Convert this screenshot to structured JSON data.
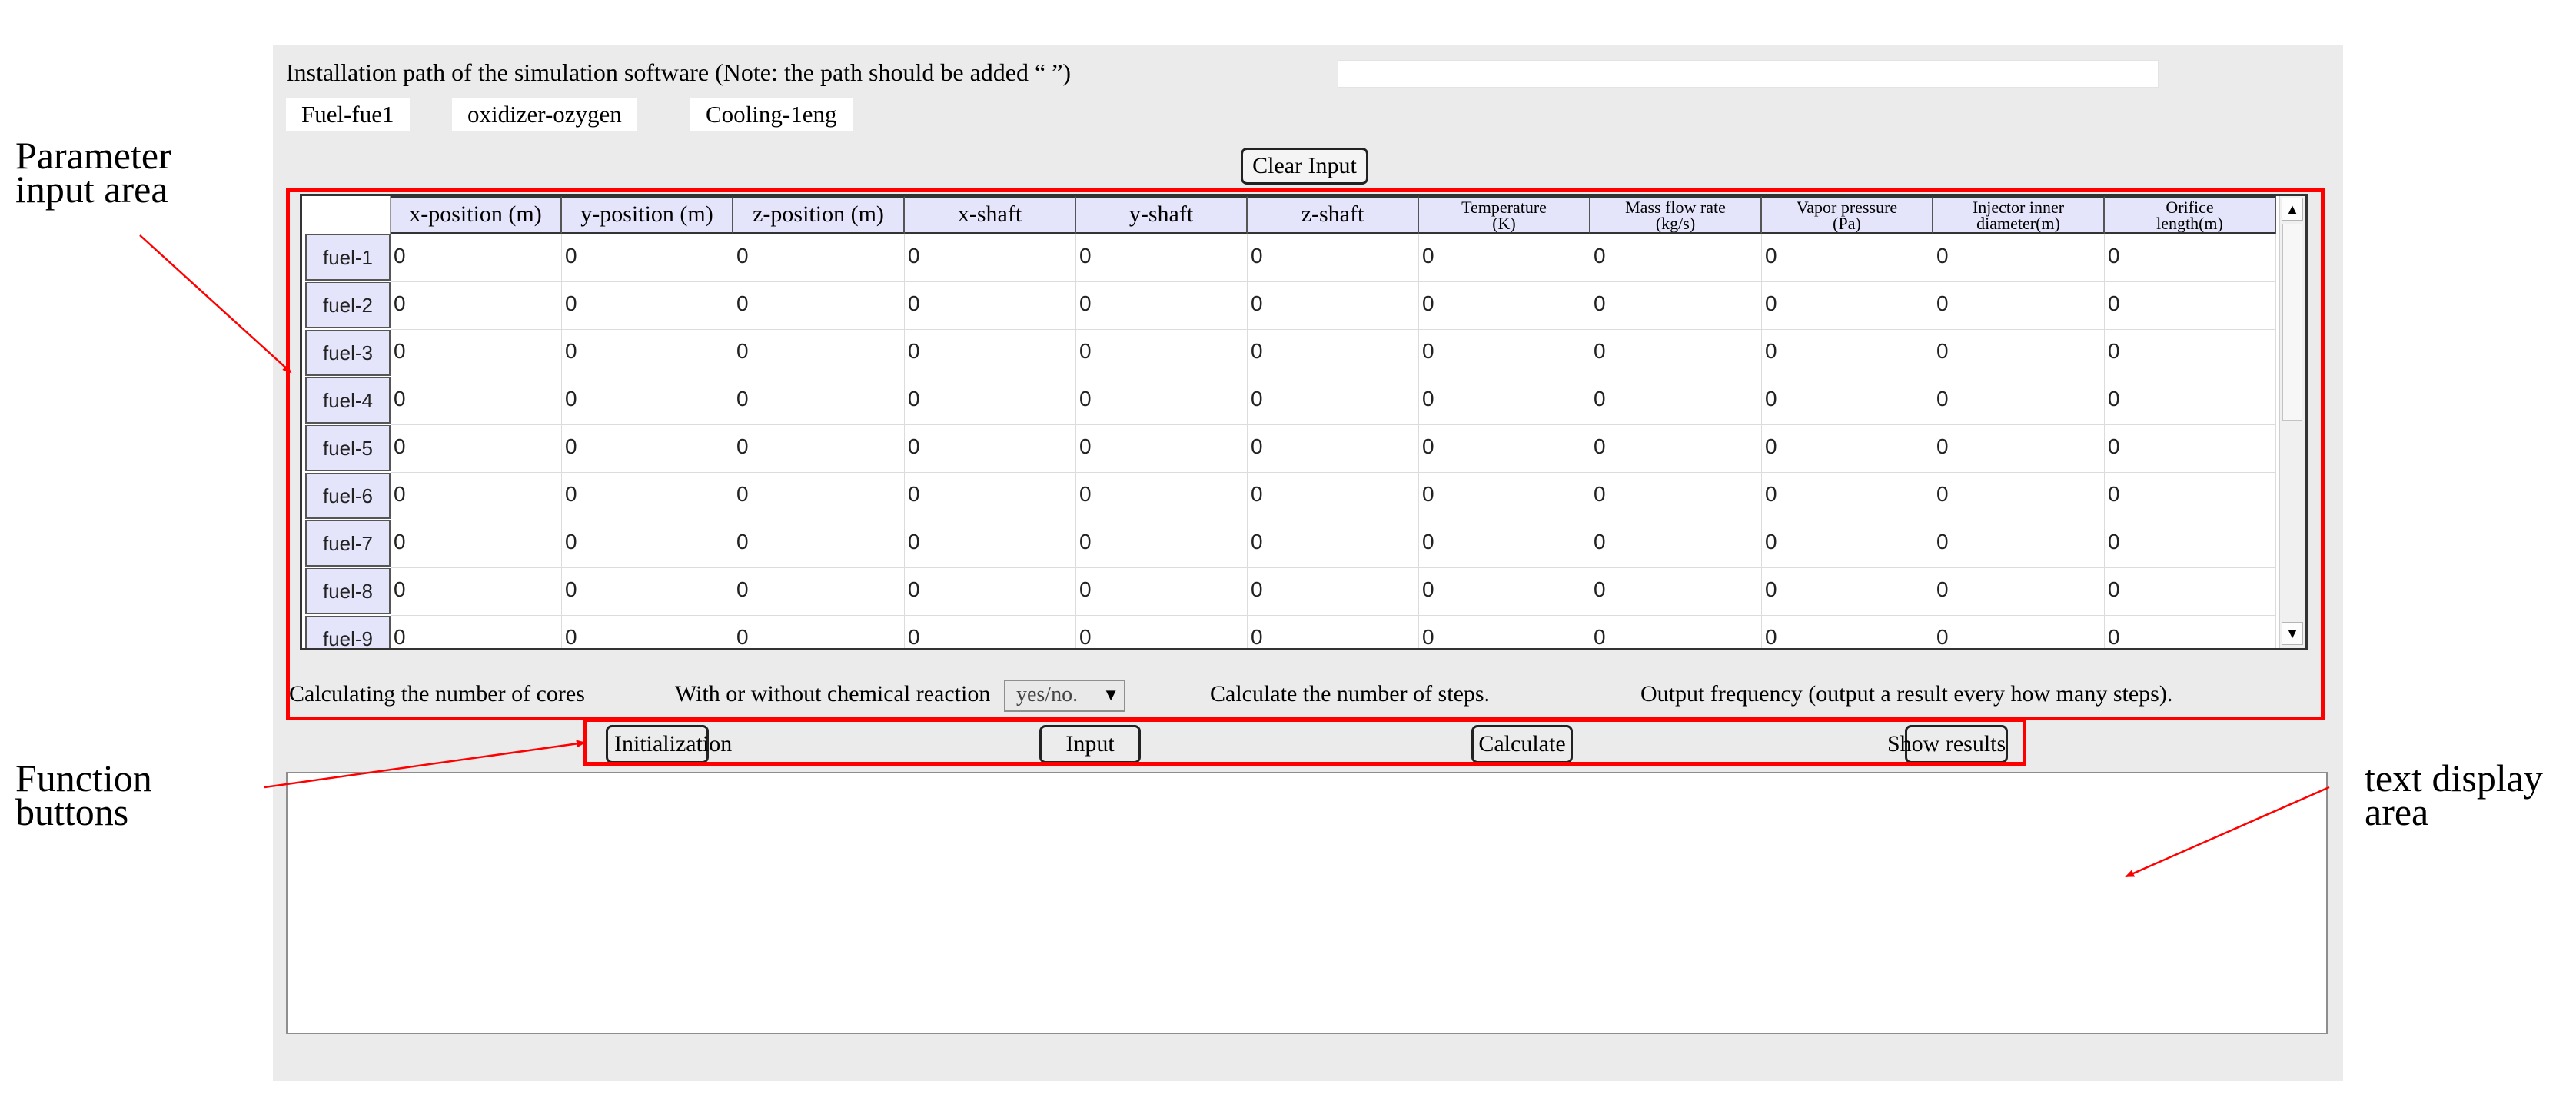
{
  "annotations": {
    "parameter_input": [
      "Parameter",
      "input area"
    ],
    "function_buttons": [
      "Function",
      "buttons"
    ],
    "text_display": [
      "text display",
      "area"
    ]
  },
  "install": {
    "label": "Installation path of the simulation software (Note: the path should be added “ ”)",
    "value": ""
  },
  "tabs": [
    "Fuel-fue1",
    "oxidizer-ozygen",
    "Cooling-1eng"
  ],
  "clear_button": "Clear Input",
  "grid": {
    "columns": [
      {
        "label": "x-position (m)",
        "lines": null
      },
      {
        "label": "y-position (m)",
        "lines": null
      },
      {
        "label": "z-position (m)",
        "lines": null
      },
      {
        "label": "x-shaft",
        "lines": null
      },
      {
        "label": "y-shaft",
        "lines": null
      },
      {
        "label": "z-shaft",
        "lines": null
      },
      {
        "label": "Temperature (K)",
        "lines": [
          "Temperature",
          "(K)"
        ]
      },
      {
        "label": "Mass flow rate (kg/s)",
        "lines": [
          "Mass flow rate",
          "(kg/s)"
        ]
      },
      {
        "label": "Vapor pressure (Pa)",
        "lines": [
          "Vapor pressure",
          "(Pa)"
        ]
      },
      {
        "label": "Injector inner diameter(m)",
        "lines": [
          "Injector inner",
          "diameter(m)"
        ]
      },
      {
        "label": "Orifice length(m)",
        "lines": [
          "Orifice",
          "length(m)"
        ]
      }
    ],
    "rows": [
      {
        "label": "fuel-1",
        "values": [
          "0",
          "0",
          "0",
          "0",
          "0",
          "0",
          "0",
          "0",
          "0",
          "0",
          "0"
        ]
      },
      {
        "label": "fuel-2",
        "values": [
          "0",
          "0",
          "0",
          "0",
          "0",
          "0",
          "0",
          "0",
          "0",
          "0",
          "0"
        ]
      },
      {
        "label": "fuel-3",
        "values": [
          "0",
          "0",
          "0",
          "0",
          "0",
          "0",
          "0",
          "0",
          "0",
          "0",
          "0"
        ]
      },
      {
        "label": "fuel-4",
        "values": [
          "0",
          "0",
          "0",
          "0",
          "0",
          "0",
          "0",
          "0",
          "0",
          "0",
          "0"
        ]
      },
      {
        "label": "fuel-5",
        "values": [
          "0",
          "0",
          "0",
          "0",
          "0",
          "0",
          "0",
          "0",
          "0",
          "0",
          "0"
        ]
      },
      {
        "label": "fuel-6",
        "values": [
          "0",
          "0",
          "0",
          "0",
          "0",
          "0",
          "0",
          "0",
          "0",
          "0",
          "0"
        ]
      },
      {
        "label": "fuel-7",
        "values": [
          "0",
          "0",
          "0",
          "0",
          "0",
          "0",
          "0",
          "0",
          "0",
          "0",
          "0"
        ]
      },
      {
        "label": "fuel-8",
        "values": [
          "0",
          "0",
          "0",
          "0",
          "0",
          "0",
          "0",
          "0",
          "0",
          "0",
          "0"
        ]
      },
      {
        "label": "fuel-9",
        "values": [
          "0",
          "0",
          "0",
          "0",
          "0",
          "0",
          "0",
          "0",
          "0",
          "0",
          "0"
        ]
      }
    ]
  },
  "params": {
    "cores_label": "Calculating the number of cores",
    "reaction_label": "With or without chemical reaction",
    "reaction_select": "yes/no.",
    "steps_label": "Calculate the number of steps.",
    "frequency_label": "Output frequency (output a result every how many steps)."
  },
  "buttons": {
    "init": "Initialization",
    "input": "Input",
    "calculate": "Calculate",
    "show": "Show results"
  },
  "text_display": "",
  "icons": {
    "scroll_up": "triangle-up-icon",
    "scroll_down": "triangle-down-icon",
    "dropdown": "triangle-down-icon"
  },
  "colors": {
    "highlight": "#ff0000",
    "header_bg": "#e4e4fa",
    "panel_bg": "#ebebeb"
  }
}
